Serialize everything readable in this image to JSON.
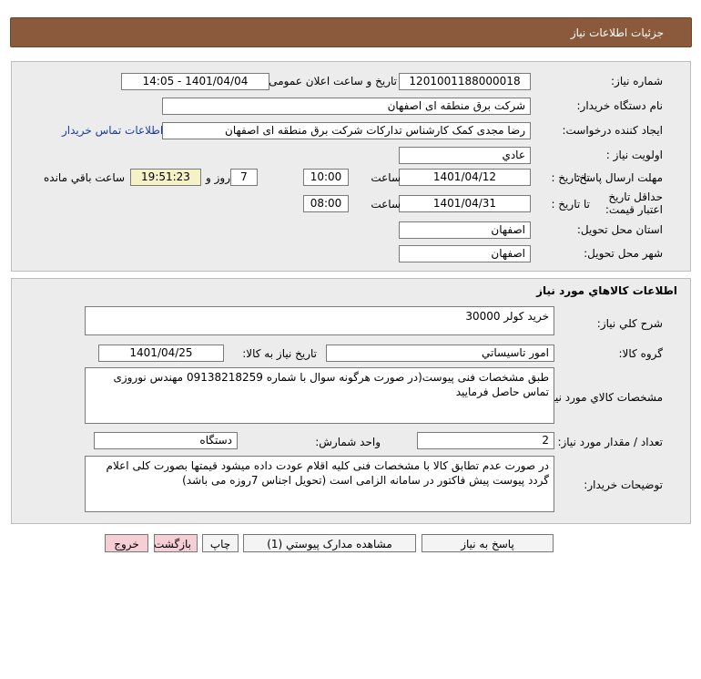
{
  "header": {
    "title": "جزئیات اطلاعات نیاز"
  },
  "info": {
    "need_number_label": "شماره نیاز:",
    "need_number": "1201001188000018",
    "announce_label": "تاریخ و ساعت اعلان عمومی:",
    "announce_value": "1401/04/04 - 14:05",
    "buyer_org_label": "نام دستگاه خريدار:",
    "buyer_org": "شرکت برق منطقه ای اصفهان",
    "creator_label": "ايجاد کننده درخواست:",
    "creator": "رضا  مجدی کمک کارشناس تدارکات شرکت برق منطقه ای اصفهان",
    "contact_link": "اطلاعات تماس خريدار",
    "priority_label": "اولويت نياز :",
    "priority": "عادي",
    "deadline_label": "مهلت ارسال پاسخ:",
    "until_date_label": "تا تاريخ :",
    "deadline_date": "1401/04/12",
    "time_label": "ساعت",
    "deadline_time": "10:00",
    "days_value": "7",
    "days_and_label": "روز و",
    "remaining_time": "19:51:23",
    "remaining_label": "ساعت باقي مانده",
    "validity_label": "حداقل تاريخ اعتبار قيمت:",
    "validity_date": "1401/04/31",
    "validity_time": "08:00",
    "province_label": "استان محل تحويل:",
    "province": "اصفهان",
    "city_label": "شهر محل تحويل:",
    "city": "اصفهان"
  },
  "goods": {
    "section_title": "اطلاعات کالاهاي مورد نياز",
    "summary_label": "شرح کلي نياز:",
    "summary": "خرید کولر 30000",
    "group_label": "گروه کالا:",
    "group": "امور تاسيساتي",
    "need_date_label": "تاریخ نیاز به کالا:",
    "need_date": "1401/04/25",
    "specs_label": "مشخصات کالاي مورد نياز:",
    "specs": "طبق مشخصات فنی پیوست(در صورت هرگونه سوال با شماره 09138218259 مهندس نوروزی تماس حاصل فرمایید",
    "qty_label": "تعداد / مقدار مورد نياز:",
    "qty": "2",
    "unit_label": "واحد شمارش:",
    "unit": "دستگاه",
    "notes_label": "توضيحات خريدار:",
    "notes": "در صورت عدم تطابق کالا با مشخصات فنی کلیه اقلام عودت داده میشود قیمتها بصورت کلی اعلام گردد پیوست پیش فاکتور در سامانه الزامی است (تحویل اجناس 7روزه می باشد)"
  },
  "buttons": {
    "reply": "پاسخ به نياز",
    "attachments": "مشاهده مدارک پيوستي (1)",
    "print": "چاپ",
    "back": "بازگشت",
    "exit": "خروج"
  }
}
